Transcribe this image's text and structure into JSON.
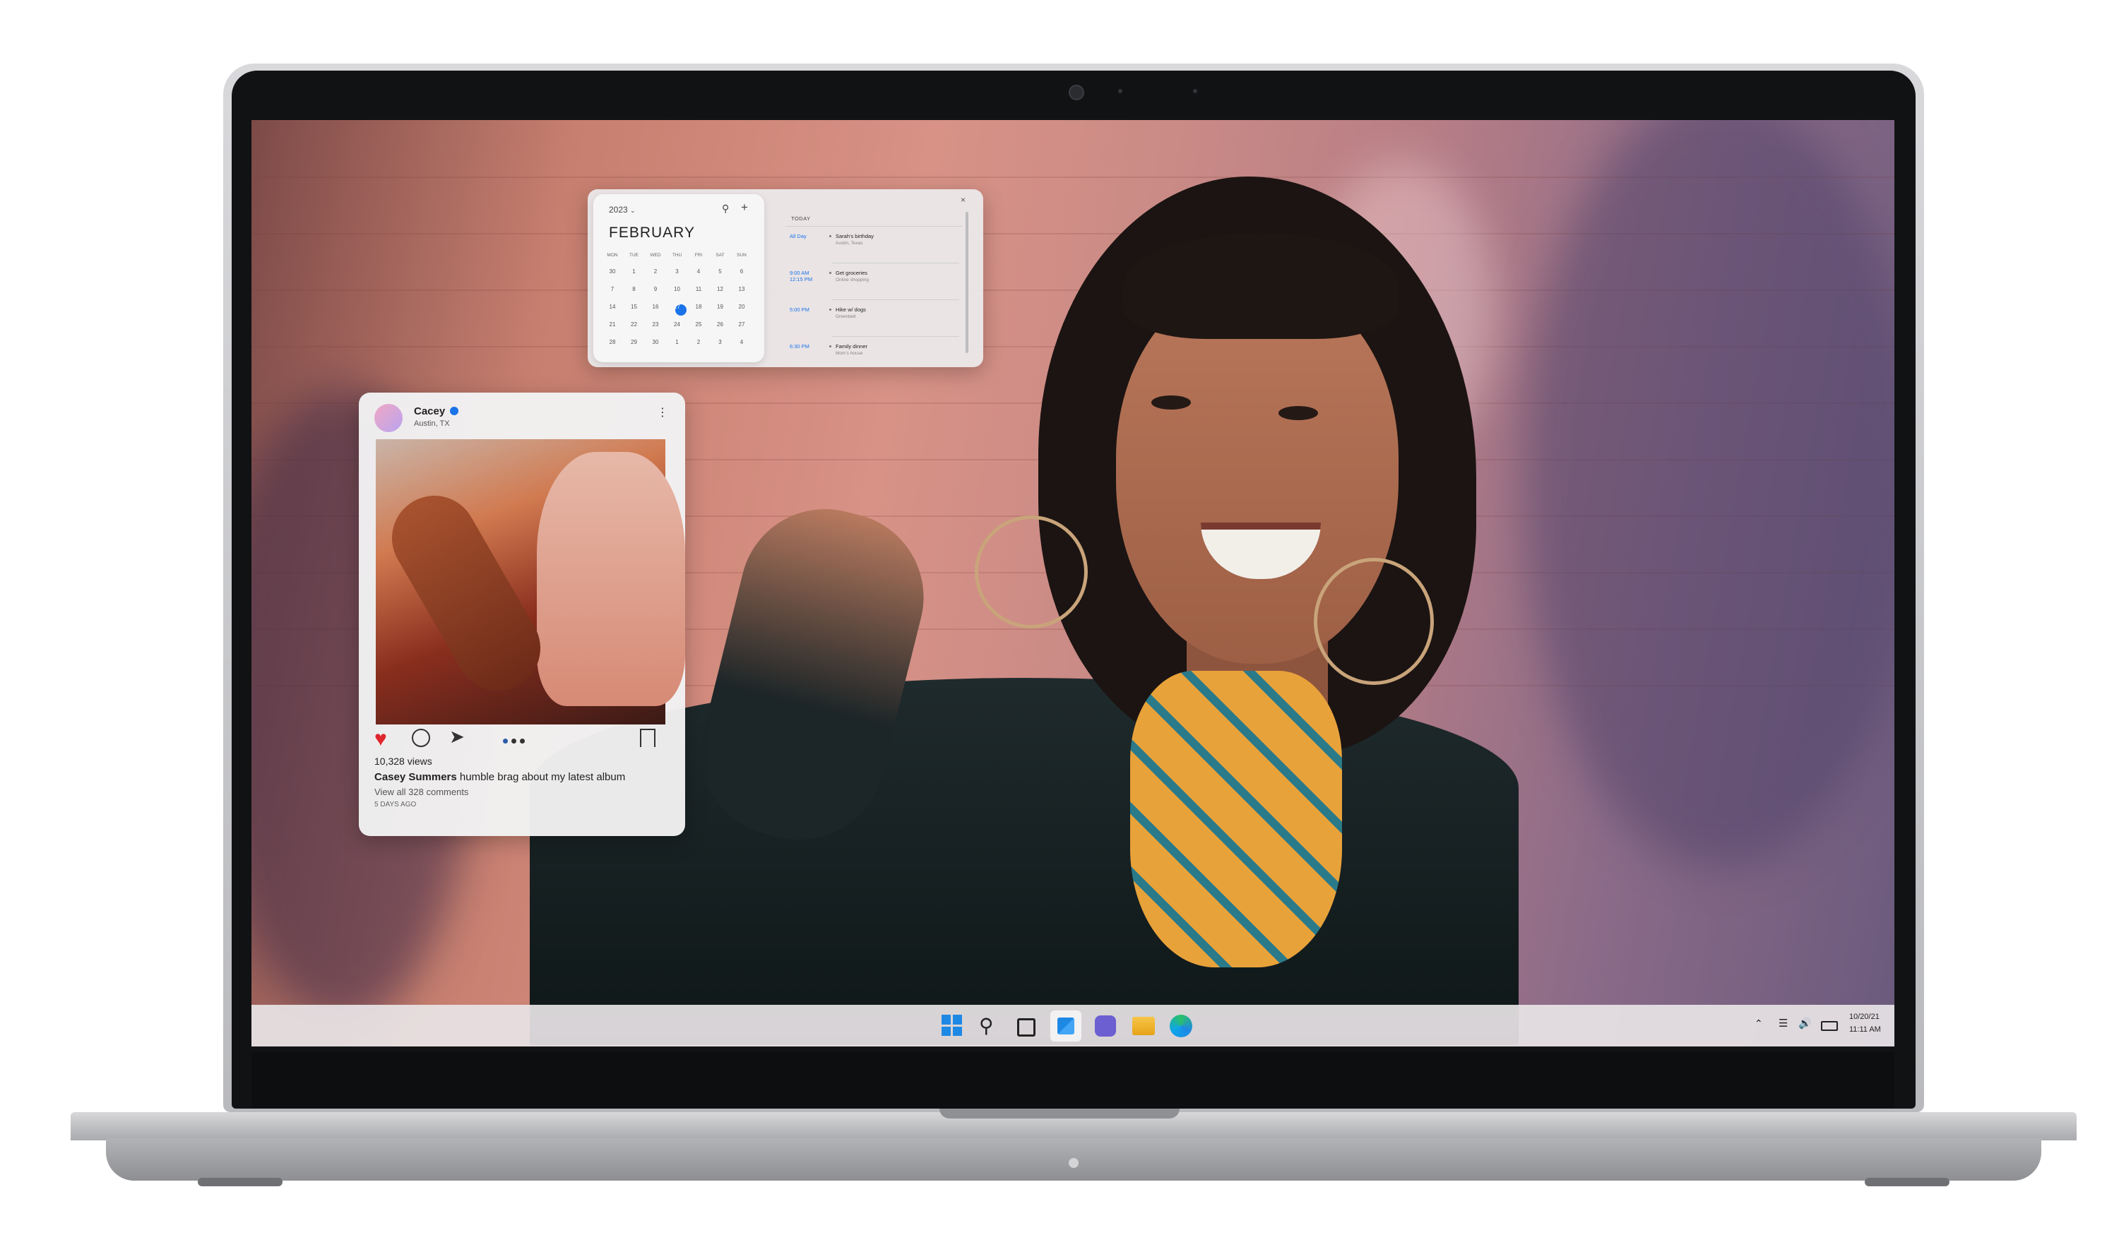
{
  "calendar_widget": {
    "year_label": "2023",
    "month": "FEBRUARY",
    "weekdays": [
      "MON",
      "TUE",
      "WED",
      "THU",
      "FRI",
      "SAT",
      "SUN"
    ],
    "weeks": [
      [
        "30",
        "1",
        "2",
        "3",
        "4",
        "5",
        "6"
      ],
      [
        "7",
        "8",
        "9",
        "10",
        "11",
        "12",
        "13"
      ],
      [
        "14",
        "15",
        "16",
        "17",
        "18",
        "19",
        "20"
      ],
      [
        "21",
        "22",
        "23",
        "24",
        "25",
        "26",
        "27"
      ],
      [
        "28",
        "29",
        "30",
        "1",
        "2",
        "3",
        "4"
      ]
    ],
    "selected_day": "17",
    "agenda_heading": "TODAY",
    "events": [
      {
        "time": "All Day",
        "title": "Sarah's birthday",
        "detail": "Austin, Texas"
      },
      {
        "time": "9:00 AM\n12:15 PM",
        "title": "Get groceries",
        "detail": "Online shopping"
      },
      {
        "time": "5:00 PM",
        "title": "Hike w/ dogs",
        "detail": "Greenbelt"
      },
      {
        "time": "6:30 PM",
        "title": "Family dinner",
        "detail": "Mom's house"
      }
    ]
  },
  "social_widget": {
    "username": "Cacey",
    "location": "Austin, TX",
    "views": "10,328 views",
    "caption_user": "Casey Summers",
    "caption_text": "humble brag about my latest album",
    "comments_link": "View all 328 comments",
    "posted": "5 DAYS AGO"
  },
  "taskbar": {
    "icons": [
      "windows-start-icon",
      "search-icon",
      "task-view-icon",
      "widgets-icon",
      "teams-chat-icon",
      "file-explorer-icon",
      "edge-browser-icon"
    ],
    "date": "10/20/21",
    "time": "11:11 AM"
  },
  "colors": {
    "accent": "#1a73e8",
    "like": "#e0262d"
  }
}
